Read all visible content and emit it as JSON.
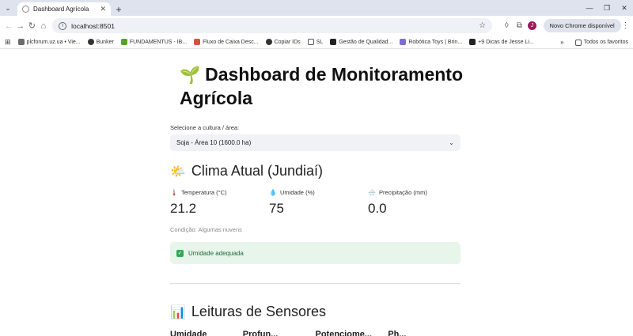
{
  "browser": {
    "tab_title": "Dashboard Agrícola",
    "url": "localhost:8501",
    "update_button": "Novo Chrome disponível",
    "profile_initial": "J",
    "bookmarks": [
      {
        "label": "plcforum.uz.ua • Vie...",
        "color": "#6b6b6b"
      },
      {
        "label": "Bunker",
        "color": "#333333"
      },
      {
        "label": "FUNDAMENTUS - IB...",
        "color": "#5aa02c"
      },
      {
        "label": "Fluxo de Caixa Desc...",
        "color": "#d0553b"
      },
      {
        "label": "Copiar IDs",
        "color": "#333333"
      },
      {
        "label": "SL",
        "color": "#555555"
      },
      {
        "label": "Gestão de Qualidad...",
        "color": "#222222"
      },
      {
        "label": "Robótica Toys | Brin...",
        "color": "#7a6fd0"
      },
      {
        "label": "+9 Dicas de Jesse Li...",
        "color": "#222222"
      }
    ],
    "all_bookmarks": "Todos os favoritos"
  },
  "page": {
    "title_emoji": "🌱",
    "title": "Dashboard de Monitoramento Agrícola",
    "select_label": "Selecione a cultura / área:",
    "select_value": "Soja - Área 10 (1600.0 ha)",
    "weather_emoji": "🌤️",
    "weather_title": "Clima Atual (Jundiaí)",
    "metrics": [
      {
        "icon": "🌡️",
        "label": "Temperatura (°C)",
        "value": "21.2"
      },
      {
        "icon": "💧",
        "label": "Umidade (%)",
        "value": "75"
      },
      {
        "icon": "🌧️",
        "label": "Precipitação (mm)",
        "value": "0.0"
      }
    ],
    "condition": "Condição: Algumas nuvens",
    "alert_text": "Umidade adequada",
    "sensors_emoji": "📊",
    "sensors_title": "Leituras de Sensores",
    "cutoff_headings": [
      "Umidade",
      "Profun...",
      "Potenciome...",
      "Ph..."
    ]
  }
}
